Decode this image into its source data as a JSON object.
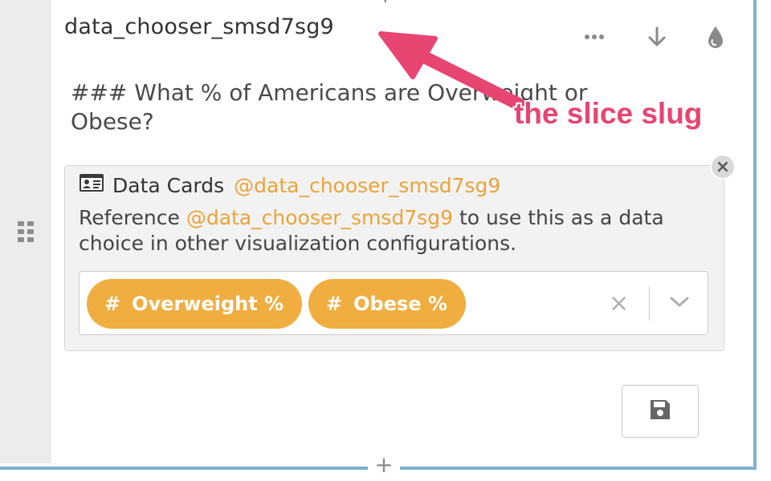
{
  "slice": {
    "slug": "data_chooser_smsd7sg9",
    "heading": "### What % of Americans are Overweight or Obese?"
  },
  "toolbar": {
    "icons": [
      "more-icon",
      "download-icon",
      "color-drop-icon"
    ]
  },
  "annotation": {
    "label": "the slice slug",
    "color": "#e74572"
  },
  "card": {
    "title": "Data Cards",
    "handle": "@data_chooser_smsd7sg9",
    "desc_prefix": "Reference",
    "desc_handle": "@data_chooser_smsd7sg9",
    "desc_suffix": " to use this as a data choice in other visualization configurations.",
    "close_label": "×"
  },
  "select": {
    "chips": [
      {
        "hash": "#",
        "label": "Overweight %"
      },
      {
        "hash": "#",
        "label": "Obese %"
      }
    ],
    "clear_label": "×"
  },
  "colors": {
    "accent": "#f0ae41",
    "handle": "#eaa43b",
    "frame": "#7fb0cf"
  }
}
